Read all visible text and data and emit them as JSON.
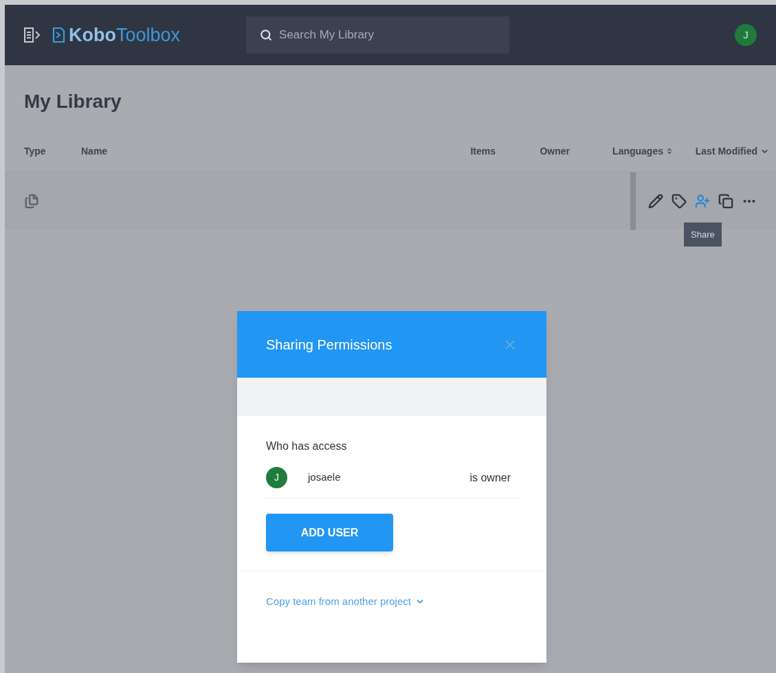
{
  "header": {
    "logo": {
      "bold": "Kobo",
      "light": "Toolbox"
    },
    "search": {
      "placeholder": "Search My Library"
    },
    "avatar": "J"
  },
  "page_title": "My Library",
  "table": {
    "columns": [
      {
        "label": "Type",
        "kind": "plain"
      },
      {
        "label": "Name",
        "kind": "plain"
      },
      {
        "label": "Items",
        "kind": "plain"
      },
      {
        "label": "Owner",
        "kind": "plain"
      },
      {
        "label": "Languages",
        "kind": "sortable"
      },
      {
        "label": "Last Modified",
        "kind": "sorted"
      }
    ],
    "rows": [
      {
        "actions": [
          {
            "kind": "edit",
            "highlighted": false
          },
          {
            "kind": "tag",
            "highlighted": false
          },
          {
            "kind": "share",
            "highlighted": true
          },
          {
            "kind": "clone",
            "highlighted": false
          },
          {
            "kind": "more",
            "highlighted": false
          }
        ]
      }
    ]
  },
  "tooltip": "Share",
  "dialog": {
    "title": "Sharing Permissions",
    "section_label": "Who has access",
    "users": [
      {
        "initial": "J",
        "name": "josaele",
        "role": "is owner"
      }
    ],
    "add_button": "ADD USER",
    "copy_link": "Copy team from another project"
  }
}
